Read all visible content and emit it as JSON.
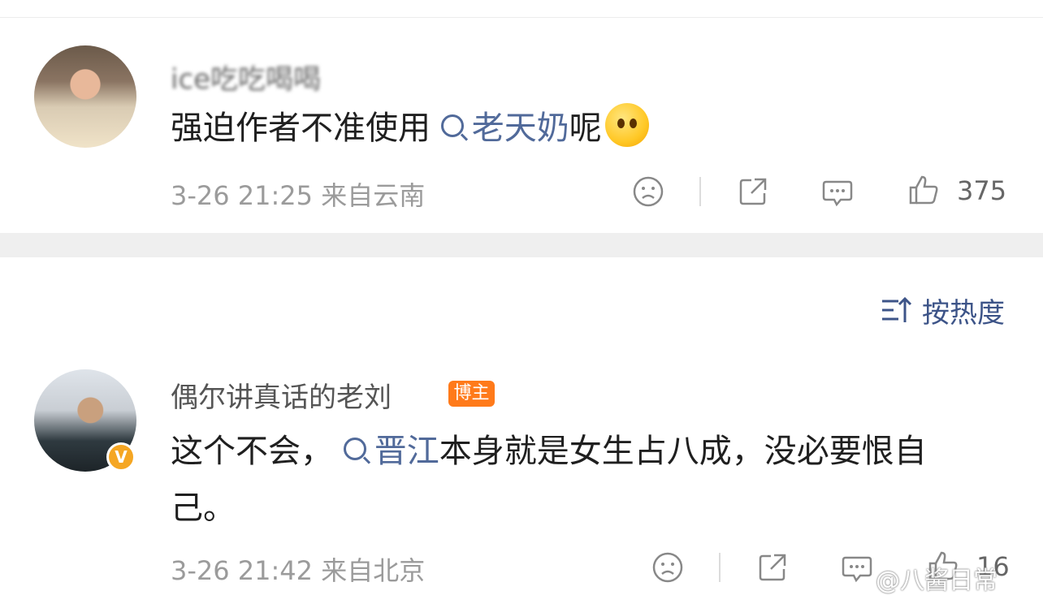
{
  "comments": [
    {
      "username": "ice吃吃喝喝",
      "text_before": "强迫作者不准使用",
      "topic": "老天奶",
      "text_after": "呢",
      "emoji": "hug-emoji",
      "time": "3-26 21:25",
      "location": "来自云南",
      "likes": "375"
    },
    {
      "username": "偶尔讲真话的老刘",
      "tag": "博主",
      "verified_badge": "V",
      "text_before": "这个不会，",
      "topic": "晋江",
      "text_after_line1": "本身就是女生占八成，没必要恨自",
      "text_line2": "己。",
      "time": "3-26 21:42",
      "location": "来自北京",
      "likes": "16"
    }
  ],
  "sort": {
    "label": "按热度",
    "icon": "sort-icon"
  },
  "watermark": "@八酱日常",
  "colors": {
    "topic": "#516a9a",
    "tag": "#ff7a1a",
    "verified": "#f5a623"
  }
}
